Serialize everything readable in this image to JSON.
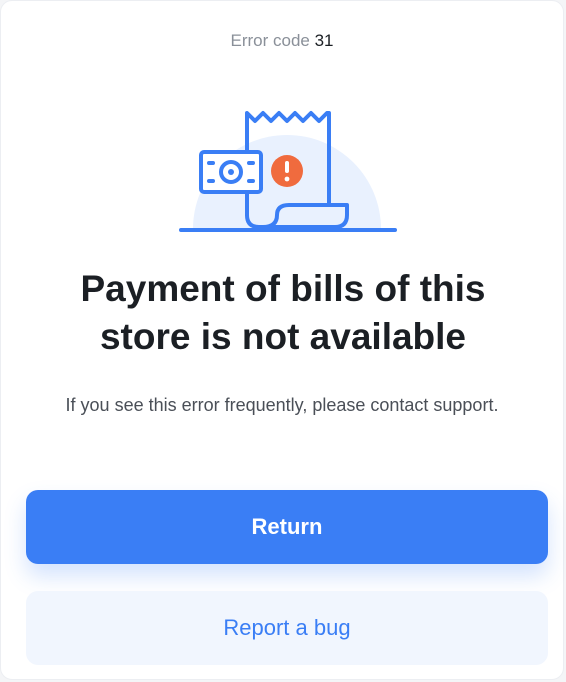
{
  "error": {
    "label": "Error code",
    "code": "31"
  },
  "illustration": {
    "icon": "receipt-payment-error-icon",
    "accent_color": "#3a7ef5",
    "alert_color": "#f06b3e"
  },
  "message": {
    "title": "Payment of bills of this store is not available",
    "subtitle": "If you see this error frequently, please contact support."
  },
  "actions": {
    "return_label": "Return",
    "report_label": "Report a bug"
  },
  "colors": {
    "primary": "#3a7ef5",
    "secondary_bg": "#f1f6fe",
    "title": "#1b1f24"
  }
}
